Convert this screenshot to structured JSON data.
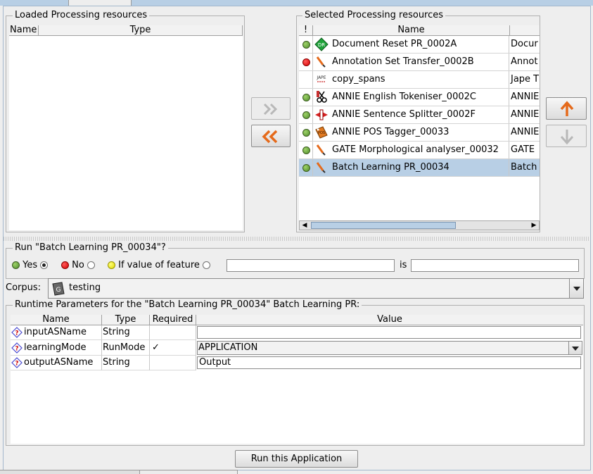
{
  "loaded": {
    "title": "Loaded Processing resources",
    "columns": [
      "Name",
      "Type"
    ]
  },
  "selected": {
    "title": "Selected Processing resources",
    "columns": [
      "!",
      "Name",
      ""
    ],
    "rows": [
      {
        "status": "green",
        "icon": "document-reset-icon",
        "name": "Document Reset PR_0002A",
        "type": "Docur"
      },
      {
        "status": "red",
        "icon": "jape-pen-icon",
        "name": "Annotation Set Transfer_0002B",
        "type": "Annot"
      },
      {
        "status": "none",
        "icon": "jape-icon",
        "name": "copy_spans",
        "type": "Jape T"
      },
      {
        "status": "green",
        "icon": "tokeniser-icon",
        "name": "ANNIE English Tokeniser_0002C",
        "type": "ANNIE"
      },
      {
        "status": "green",
        "icon": "splitter-icon",
        "name": "ANNIE Sentence Splitter_0002F",
        "type": "ANNIE"
      },
      {
        "status": "green",
        "icon": "pos-tagger-icon",
        "name": "ANNIE POS Tagger_00033",
        "type": "ANNIE"
      },
      {
        "status": "green",
        "icon": "morph-pen-icon",
        "name": "GATE Morphological analyser_00032",
        "type": "GATE"
      },
      {
        "status": "green",
        "icon": "learning-pen-icon",
        "name": "Batch Learning PR_00034",
        "type": "Batch"
      }
    ]
  },
  "run_condition": {
    "title": "Run \"Batch Learning PR_00034\"?",
    "yes_label": "Yes",
    "no_label": "No",
    "feature_label": "If value of feature",
    "is_label": "is",
    "feature_value": "",
    "is_value": ""
  },
  "corpus": {
    "label": "Corpus:",
    "value": "testing"
  },
  "runtime": {
    "title": "Runtime Parameters for the \"Batch Learning PR_00034\" Batch Learning PR:",
    "columns": [
      "Name",
      "Type",
      "Required",
      "Value"
    ],
    "rows": [
      {
        "name": "inputASName",
        "type": "String",
        "required": "",
        "value": ""
      },
      {
        "name": "learningMode",
        "type": "RunMode",
        "required": "✓",
        "value": "APPLICATION"
      },
      {
        "name": "outputASName",
        "type": "String",
        "required": "",
        "value": "Output"
      }
    ]
  },
  "run_button": "Run this Application",
  "colors": {
    "accent": "#b8cfe5",
    "green": "#4e8b2a",
    "red": "#d40000",
    "orange_arrow": "#e56a1b"
  }
}
